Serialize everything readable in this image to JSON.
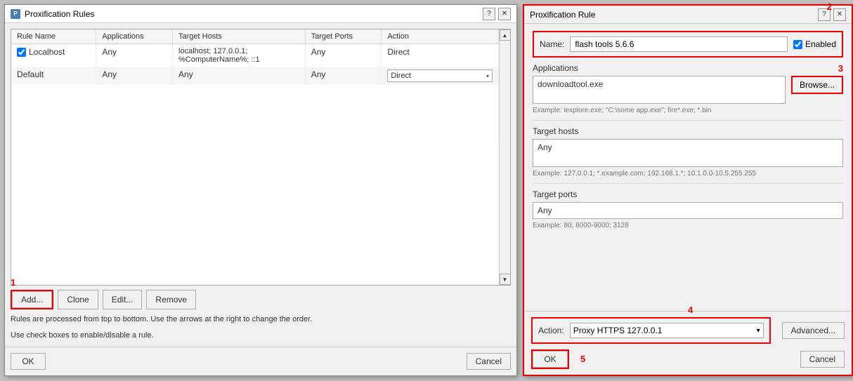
{
  "leftDialog": {
    "title": "Proxification Rules",
    "columns": [
      "Rule Name",
      "Applications",
      "Target Hosts",
      "Target Ports",
      "Action"
    ],
    "rows": [
      {
        "name": "Localhost",
        "checkbox": true,
        "applications": "Any",
        "targetHosts": "localhost; 127.0.0.1;\n%ComputerName%; ::1",
        "targetPorts": "Any",
        "action": "Direct",
        "isDropdown": false
      },
      {
        "name": "Default",
        "checkbox": false,
        "applications": "Any",
        "targetHosts": "Any",
        "targetPorts": "Any",
        "action": "Direct",
        "isDropdown": true
      }
    ],
    "buttons": {
      "add": "Add...",
      "clone": "Clone",
      "edit": "Edit...",
      "remove": "Remove"
    },
    "info1": "Rules are processed from top to bottom. Use the arrows at the right to change the order.",
    "info2": "Use check boxes to enable/disable a rule.",
    "footer": {
      "ok": "OK",
      "cancel": "Cancel"
    },
    "annotation1": "1"
  },
  "rightDialog": {
    "title": "Proxification Rule",
    "annotation2": "2",
    "name": {
      "label": "Name:",
      "value": "flash tools 5.6.6",
      "placeholder": "flash tools 5.6.6"
    },
    "enabled": {
      "label": "Enabled",
      "checked": true
    },
    "applications": {
      "label": "Applications",
      "value": "downloadtool.exe",
      "example": "Example: iexplore.exe; \"C:\\some app.exe\"; fire*.exe; *.bin",
      "browseLabel": "Browse...",
      "annotation3": "3"
    },
    "targetHosts": {
      "label": "Target hosts",
      "value": "Any",
      "example": "Example: 127.0.0.1; *.example.com; 192.168.1.*; 10.1.0.0-10.5.255.255"
    },
    "targetPorts": {
      "label": "Target ports",
      "value": "Any",
      "example": "Example: 80; 8000-9000; 3128"
    },
    "footer": {
      "actionLabel": "Action:",
      "actionValue": "Proxy HTTPS 127.0.0.1",
      "annotation4": "4",
      "advancedLabel": "Advanced...",
      "ok": "OK",
      "cancel": "Cancel",
      "annotation5": "5"
    }
  }
}
